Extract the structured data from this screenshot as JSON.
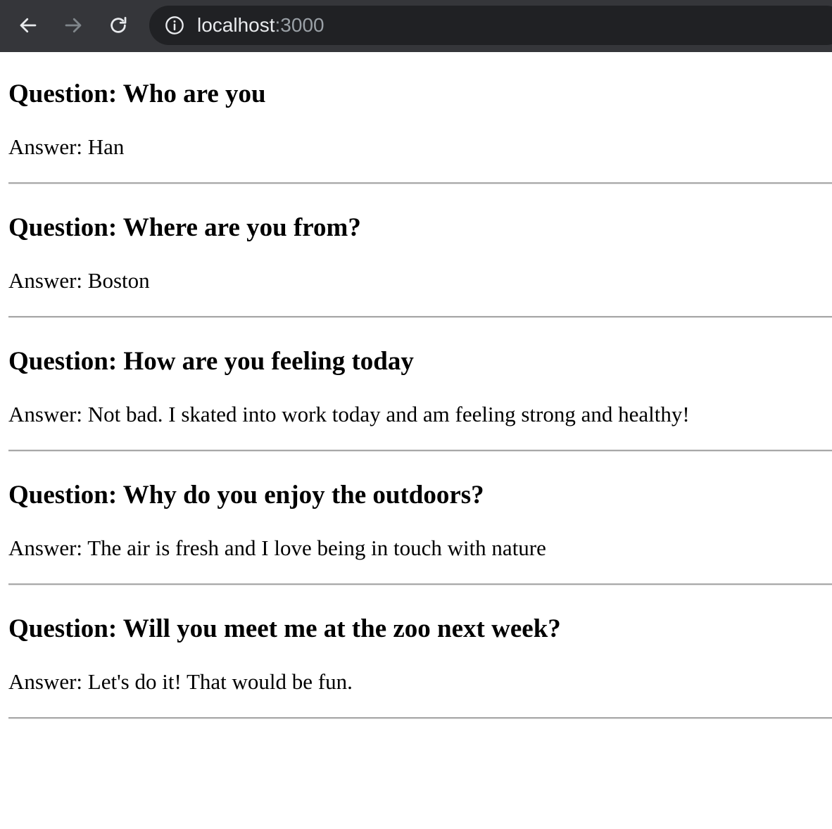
{
  "browser": {
    "url_host": "localhost",
    "url_port": ":3000",
    "icons": {
      "back": "arrow-left-icon",
      "forward": "arrow-right-icon",
      "reload": "reload-icon",
      "info": "info-icon"
    },
    "colors": {
      "toolbar_bg": "#35363a",
      "address_bg": "#202124",
      "icon_active": "#e8eaed",
      "icon_disabled": "#80868b"
    }
  },
  "qa": [
    {
      "question": "Question: Who are you",
      "answer": "Answer: Han"
    },
    {
      "question": "Question: Where are you from?",
      "answer": "Answer: Boston"
    },
    {
      "question": "Question: How are you feeling today",
      "answer": "Answer: Not bad. I skated into work today and am feeling strong and healthy!"
    },
    {
      "question": "Question: Why do you enjoy the outdoors?",
      "answer": "Answer: The air is fresh and I love being in touch with nature"
    },
    {
      "question": "Question: Will you meet me at the zoo next week?",
      "answer": "Answer: Let's do it! That would be fun."
    }
  ]
}
